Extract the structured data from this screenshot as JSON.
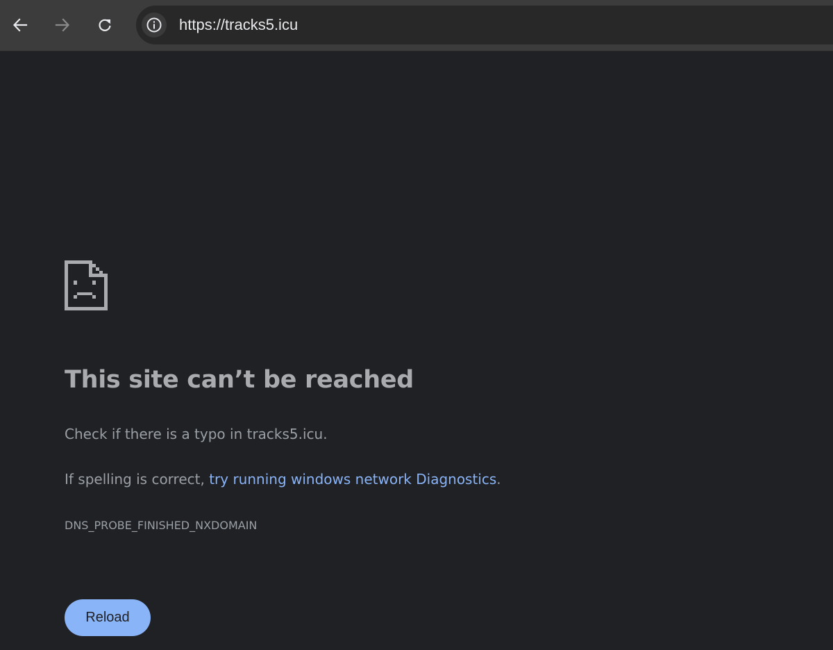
{
  "browser": {
    "url": "https://tracks5.icu",
    "icons": {
      "back": "arrow-left-icon",
      "forward": "arrow-right-icon",
      "reload": "reload-icon",
      "site_info": "info-icon"
    }
  },
  "error_page": {
    "icon": "sad-page-icon",
    "title": "This site can’t be reached",
    "line1": "Check if there is a typo in tracks5.icu.",
    "line2_prefix": "If spelling is correct, ",
    "line2_link": "try running windows network Diagnostics",
    "line2_suffix": ".",
    "error_code": "DNS_PROBE_FINISHED_NXDOMAIN",
    "reload_label": "Reload"
  },
  "colors": {
    "page_background": "#202124",
    "toolbar_background": "#3c3c3c",
    "omnibox_background": "#282828",
    "link": "#8ab4f8",
    "button": "#8ab4f8",
    "text": "#9aa0a6"
  }
}
